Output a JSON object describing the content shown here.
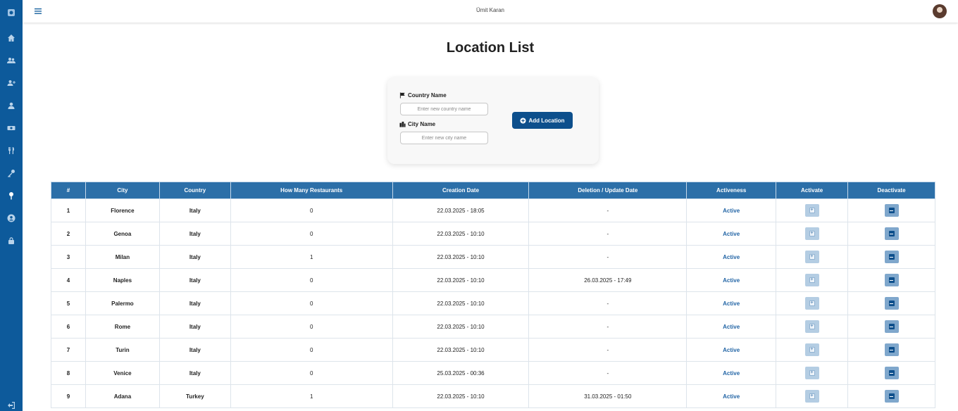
{
  "header": {
    "user_name": "Ümit Karan"
  },
  "sidebar": {
    "icons": [
      "app-logo-icon",
      "home-icon",
      "users-icon",
      "add-user-icon",
      "user-icon",
      "money-icon",
      "restaurant-icon",
      "key-icon",
      "location-pin-icon",
      "account-circle-icon",
      "lock-icon",
      "logout-icon"
    ]
  },
  "page": {
    "title": "Location List"
  },
  "form": {
    "country_label": "Country Name",
    "country_placeholder": "Enter new country name",
    "city_label": "City Name",
    "city_placeholder": "Enter new city name",
    "add_button_label": "Add Location"
  },
  "table": {
    "headers": [
      "#",
      "City",
      "Country",
      "How Many Restaurants",
      "Creation Date",
      "Deletion / Update Date",
      "Activeness",
      "Activate",
      "Deactivate"
    ],
    "rows": [
      {
        "no": "1",
        "city": "Florence",
        "country": "Italy",
        "restaurants": "0",
        "created": "22.03.2025 - 18:05",
        "updated": "-",
        "status": "Active"
      },
      {
        "no": "2",
        "city": "Genoa",
        "country": "Italy",
        "restaurants": "0",
        "created": "22.03.2025 - 10:10",
        "updated": "-",
        "status": "Active"
      },
      {
        "no": "3",
        "city": "Milan",
        "country": "Italy",
        "restaurants": "1",
        "created": "22.03.2025 - 10:10",
        "updated": "-",
        "status": "Active"
      },
      {
        "no": "4",
        "city": "Naples",
        "country": "Italy",
        "restaurants": "0",
        "created": "22.03.2025 - 10:10",
        "updated": "26.03.2025 - 17:49",
        "status": "Active"
      },
      {
        "no": "5",
        "city": "Palermo",
        "country": "Italy",
        "restaurants": "0",
        "created": "22.03.2025 - 10:10",
        "updated": "-",
        "status": "Active"
      },
      {
        "no": "6",
        "city": "Rome",
        "country": "Italy",
        "restaurants": "0",
        "created": "22.03.2025 - 10:10",
        "updated": "-",
        "status": "Active"
      },
      {
        "no": "7",
        "city": "Turin",
        "country": "Italy",
        "restaurants": "0",
        "created": "22.03.2025 - 10:10",
        "updated": "-",
        "status": "Active"
      },
      {
        "no": "8",
        "city": "Venice",
        "country": "Italy",
        "restaurants": "0",
        "created": "25.03.2025 - 00:36",
        "updated": "-",
        "status": "Active"
      },
      {
        "no": "9",
        "city": "Adana",
        "country": "Turkey",
        "restaurants": "1",
        "created": "22.03.2025 - 10:10",
        "updated": "31.03.2025 - 01:50",
        "status": "Active"
      }
    ]
  }
}
